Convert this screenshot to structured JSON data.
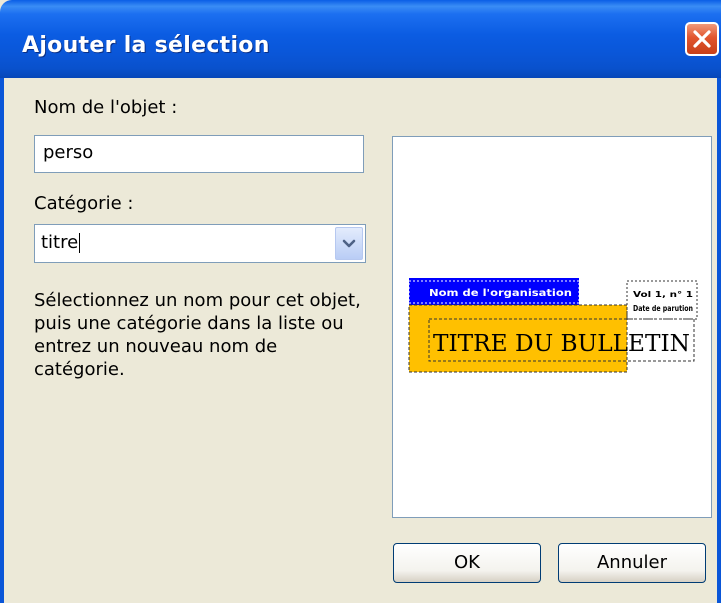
{
  "dialog": {
    "title": "Ajouter la sélection",
    "name_label": "Nom de l'objet :",
    "name_value": "perso",
    "category_label": "Catégorie :",
    "category_value": "titre",
    "description": "Sélectionnez un nom pour cet objet, puis une catégorie dans la liste ou entrez un nouveau nom de catégorie.",
    "ok_label": "OK",
    "cancel_label": "Annuler"
  },
  "preview": {
    "org_name": "Nom de l'organisation",
    "newsletter_title": "TITRE DU BULLETIN",
    "issue_line1": "Vol 1, n° 1",
    "issue_line2": "Date de parution"
  },
  "colors": {
    "titlebar": "#0a56d8",
    "close": "#e2552e",
    "dialog_bg": "#ece9d8",
    "preview_blue": "#0000ff",
    "preview_gold": "#ffc000"
  }
}
